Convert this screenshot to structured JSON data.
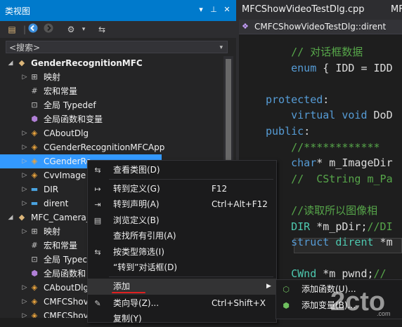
{
  "classview": {
    "title": "类视图",
    "title_buttons": [
      "pin-icon",
      "close-icon",
      "dropdown-icon"
    ],
    "search_placeholder": "<搜索>",
    "tree": [
      {
        "label": "GenderRecognitionMFC",
        "icon": "project-icon",
        "expanded": true,
        "bold": true
      },
      {
        "label": "映射",
        "icon": "map-icon"
      },
      {
        "label": "宏和常量",
        "icon": "macro-icon"
      },
      {
        "label": "全局 Typedef",
        "icon": "typedef-icon"
      },
      {
        "label": "全局函数和变量",
        "icon": "global-icon"
      },
      {
        "label": "CAboutDlg",
        "icon": "class-icon"
      },
      {
        "label": "CGenderRecognitionMFCApp",
        "icon": "class-icon"
      },
      {
        "label": "CGenderRe",
        "icon": "class-icon",
        "selected": true
      },
      {
        "label": "CvvImage",
        "icon": "class-icon"
      },
      {
        "label": "DIR",
        "icon": "struct-icon"
      },
      {
        "label": "dirent",
        "icon": "struct-icon"
      },
      {
        "label": "MFC_Camera_",
        "icon": "project-icon",
        "expanded": true
      },
      {
        "label": "映射",
        "icon": "map-icon"
      },
      {
        "label": "宏和常量",
        "icon": "macro-icon"
      },
      {
        "label": "全局 Typec",
        "icon": "typedef-icon"
      },
      {
        "label": "全局函数和",
        "icon": "global-icon"
      },
      {
        "label": "CAboutDlg",
        "icon": "class-icon"
      },
      {
        "label": "CMFCShov",
        "icon": "class-icon"
      },
      {
        "label": "CMFCShov",
        "icon": "class-icon"
      }
    ]
  },
  "editor": {
    "tab_active": "MFCShowVideoTestDlg.cpp",
    "tab_next": "MF",
    "nav_class": "CMFCShowVideoTestDlg::dirent",
    "lines": [
      {
        "indent": "    ",
        "segs": [
          {
            "c": "cm",
            "t": "// 对话框数据"
          }
        ]
      },
      {
        "indent": "    ",
        "segs": [
          {
            "c": "kw",
            "t": "enum"
          },
          {
            "c": "tx",
            "t": " { IDD = IDD"
          }
        ]
      },
      {
        "indent": "",
        "segs": []
      },
      {
        "indent": "",
        "segs": [
          {
            "c": "kw",
            "t": "protected"
          },
          {
            "c": "tx",
            "t": ":"
          }
        ]
      },
      {
        "indent": "    ",
        "segs": [
          {
            "c": "kw",
            "t": "virtual"
          },
          {
            "c": "tx",
            "t": " "
          },
          {
            "c": "kw",
            "t": "void"
          },
          {
            "c": "tx",
            "t": " DoD"
          }
        ]
      },
      {
        "indent": "",
        "segs": [
          {
            "c": "kw",
            "t": "public"
          },
          {
            "c": "tx",
            "t": ":"
          }
        ]
      },
      {
        "indent": "    ",
        "segs": [
          {
            "c": "cm",
            "t": "//************"
          }
        ]
      },
      {
        "indent": "    ",
        "segs": [
          {
            "c": "kw",
            "t": "char"
          },
          {
            "c": "tx",
            "t": "* m_ImageDir"
          }
        ]
      },
      {
        "indent": "    ",
        "segs": [
          {
            "c": "cm",
            "t": "//  CString m_Pa"
          }
        ]
      },
      {
        "indent": "",
        "segs": []
      },
      {
        "indent": "    ",
        "segs": [
          {
            "c": "cm",
            "t": "//读取所以图像相"
          }
        ]
      },
      {
        "indent": "    ",
        "segs": [
          {
            "c": "ty",
            "t": "DIR"
          },
          {
            "c": "tx",
            "t": " *m_pDir;"
          },
          {
            "c": "cm",
            "t": "//DI"
          }
        ]
      },
      {
        "indent": "    ",
        "segs": [
          {
            "c": "kw",
            "t": "struct"
          },
          {
            "c": "tx",
            "t": " "
          },
          {
            "c": "ty",
            "t": "dirent"
          },
          {
            "c": "tx",
            "t": " *m"
          }
        ]
      },
      {
        "indent": "",
        "segs": []
      },
      {
        "indent": "    ",
        "segs": [
          {
            "c": "ty",
            "t": "CWnd"
          },
          {
            "c": "tx",
            "t": " *m_pwnd;"
          },
          {
            "c": "cm",
            "t": "//"
          }
        ]
      }
    ]
  },
  "context_menu": {
    "items": [
      {
        "label": "查看类图(D)",
        "shortcut": "",
        "icon": "class-diagram-icon"
      },
      {
        "sep": true
      },
      {
        "label": "转到定义(G)",
        "shortcut": "F12",
        "icon": "goto-def-icon"
      },
      {
        "label": "转到声明(A)",
        "shortcut": "Ctrl+Alt+F12",
        "icon": "goto-decl-icon"
      },
      {
        "label": "浏览定义(B)",
        "shortcut": "",
        "icon": "browse-icon"
      },
      {
        "label": "查找所有引用(A)",
        "shortcut": "",
        "icon": ""
      },
      {
        "label": "按类型筛选(I)",
        "shortcut": "",
        "icon": "filter-icon"
      },
      {
        "label": "“转到”对话框(D)",
        "shortcut": "",
        "icon": ""
      },
      {
        "sep": true
      },
      {
        "label": "添加",
        "shortcut": "",
        "icon": "",
        "submenu": true,
        "highlighted": true
      },
      {
        "label": "类向导(Z)...",
        "shortcut": "Ctrl+Shift+X",
        "icon": "wizard-icon"
      },
      {
        "label": "复制(Y)",
        "shortcut": "",
        "icon": ""
      }
    ]
  },
  "submenu": {
    "items": [
      {
        "label": "添加函数(U)...",
        "icon": "add-function-icon"
      },
      {
        "label": "添加变量(B)...",
        "icon": "add-variable-icon"
      }
    ]
  },
  "watermark": "2cto.com"
}
